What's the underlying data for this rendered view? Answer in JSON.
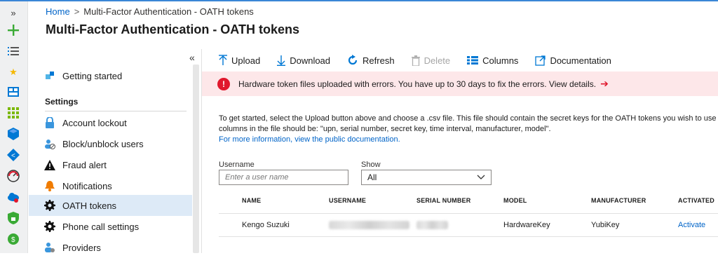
{
  "breadcrumb": {
    "home": "Home",
    "sep": ">",
    "current": "Multi-Factor Authentication - OATH tokens"
  },
  "page_title": "Multi-Factor Authentication - OATH tokens",
  "rail": {
    "expand": "»",
    "icons": [
      "plus-icon",
      "list-icon",
      "star-icon",
      "dashboard-icon",
      "all-services-icon",
      "cube-icon",
      "devops-icon",
      "monitor-icon",
      "cloud-icon",
      "security-icon",
      "cost-icon"
    ]
  },
  "menu": {
    "collapse": "«",
    "items": [
      {
        "label": "Getting started",
        "icon": "rocket-icon"
      },
      {
        "label": "Account lockout",
        "icon": "lock-icon"
      },
      {
        "label": "Block/unblock users",
        "icon": "block-users-icon"
      },
      {
        "label": "Fraud alert",
        "icon": "warning-icon"
      },
      {
        "label": "Notifications",
        "icon": "bell-icon"
      },
      {
        "label": "OATH tokens",
        "icon": "gear-icon"
      },
      {
        "label": "Phone call settings",
        "icon": "gear-icon"
      },
      {
        "label": "Providers",
        "icon": "providers-icon"
      }
    ],
    "section": "Settings",
    "active": "OATH tokens"
  },
  "toolbar": {
    "upload": "Upload",
    "download": "Download",
    "refresh": "Refresh",
    "delete": "Delete",
    "columns": "Columns",
    "documentation": "Documentation"
  },
  "banner": {
    "icon": "!",
    "message": "Hardware token files uploaded with errors. You have up to 30 days to fix the errors. View details.",
    "arrow": "➔"
  },
  "intro": {
    "line1": "To get started, select the Upload button above and choose a .csv file. This file should contain the secret keys for the OATH tokens you wish to use",
    "line2": "columns in the file should be: \"upn, serial number, secret key, time interval, manufacturer, model\".",
    "link": "For more information, view the public documentation."
  },
  "filters": {
    "username_label": "Username",
    "username_placeholder": "Enter a user name",
    "show_label": "Show",
    "show_value": "All"
  },
  "table": {
    "headers": [
      "NAME",
      "USERNAME",
      "SERIAL NUMBER",
      "MODEL",
      "MANUFACTURER",
      "ACTIVATED"
    ],
    "rows": [
      {
        "name": "Kengo Suzuki",
        "model": "HardwareKey",
        "manufacturer": "YubiKey",
        "activated": "Activate"
      }
    ]
  },
  "colors": {
    "accent": "#0064c8",
    "error": "#e0182d",
    "banner_bg": "#fde7e9",
    "active_bg": "#ddeaf7"
  }
}
